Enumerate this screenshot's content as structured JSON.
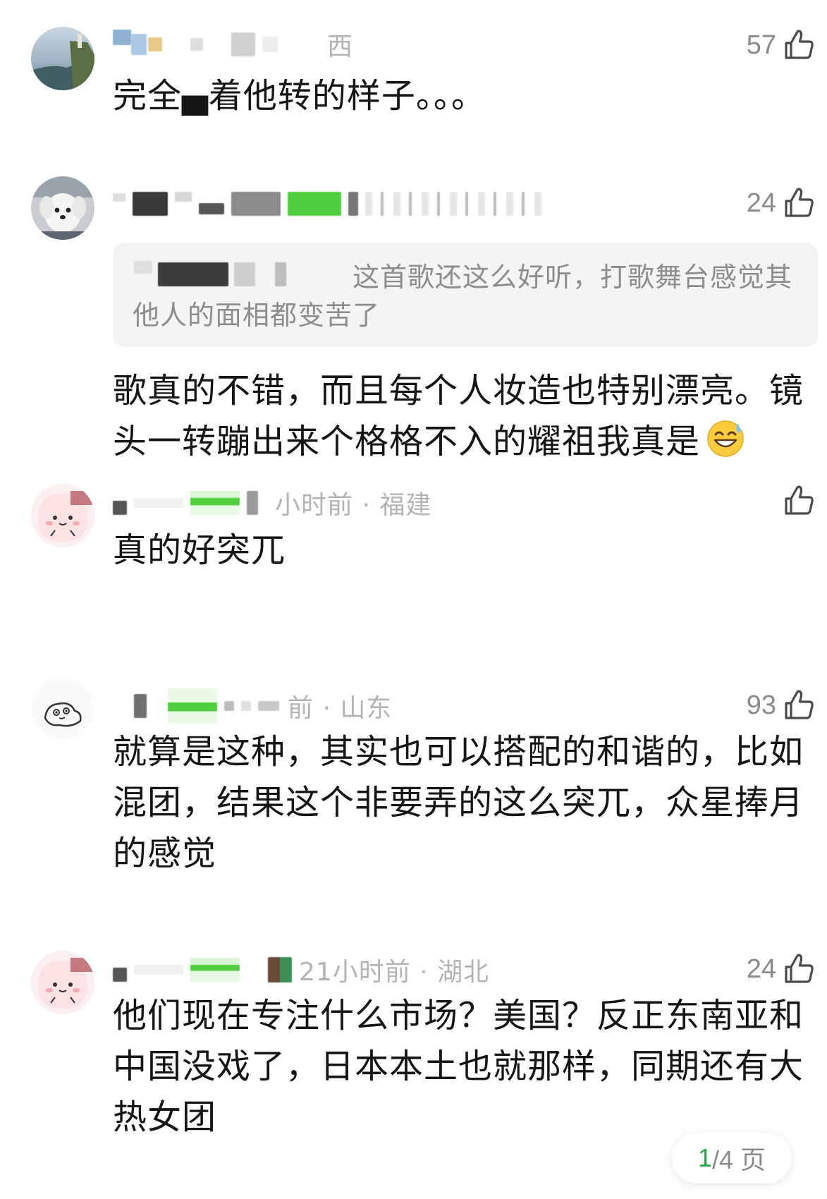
{
  "comments": [
    {
      "name_visible_suffix": "西",
      "like_count": "57",
      "text": "完全▄着他转的样子。。。"
    },
    {
      "like_count": "24",
      "quote": "这首歌还这么好听，打歌舞台感觉其他人的面相都变苦了",
      "text": "歌真的不错，而且每个人妆造也特别漂亮。镜头一转蹦出来个格格不入的耀祖我真是",
      "emoji": "sweat-smile-emoji"
    },
    {
      "meta": "小时前 · 福建",
      "like_count": "",
      "text": "真的好突兀"
    },
    {
      "meta": "前 · 山东",
      "like_count": "93",
      "text": "就算是这种，其实也可以搭配的和谐的，比如混团，结果这个非要弄的这么突兀，众星捧月的感觉"
    },
    {
      "meta": "21小时前 · 湖北",
      "like_count": "24",
      "text": "他们现在专注什么市场？美国？反正东南亚和中国没戏了，日本本土也就那样，同期还有大热女团"
    }
  ],
  "pager": {
    "current": "1",
    "rest": "/4 页"
  },
  "icons": {
    "like": "thumbs-up-icon"
  },
  "colors": {
    "accent": "#29a744",
    "meta_text": "#b3b3b3",
    "quote_bg": "#f4f4f4"
  }
}
